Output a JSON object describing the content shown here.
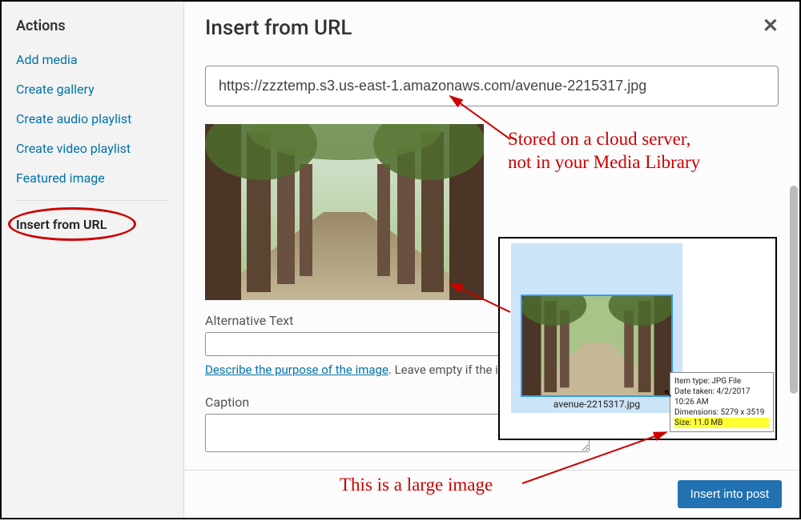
{
  "sidebar": {
    "title": "Actions",
    "items": [
      {
        "label": "Add media"
      },
      {
        "label": "Create gallery"
      },
      {
        "label": "Create audio playlist"
      },
      {
        "label": "Create video playlist"
      },
      {
        "label": "Featured image"
      }
    ],
    "active_label": "Insert from URL"
  },
  "main": {
    "title": "Insert from URL",
    "url_value": "https://zzztemp.s3.us-east-1.amazonaws.com/avenue-2215317.jpg",
    "alt_label": "Alternative Text",
    "help_link_text": "Describe the purpose of the image",
    "help_suffix": ". Leave empty if the i",
    "caption_label": "Caption",
    "insert_button": "Insert into post"
  },
  "popup": {
    "filename": "avenue-2215317.jpg",
    "tooltip": {
      "line1": "Item type: JPG File",
      "line2": "Date taken: 4/2/2017 10:26 AM",
      "line3": "Dimensions: 5279 x 3519",
      "line4": "Size: 11.0 MB"
    }
  },
  "annotations": {
    "cloud_line1": "Stored on a cloud server,",
    "cloud_line2": "not in your Media Library",
    "large_image": "This is a large image"
  }
}
